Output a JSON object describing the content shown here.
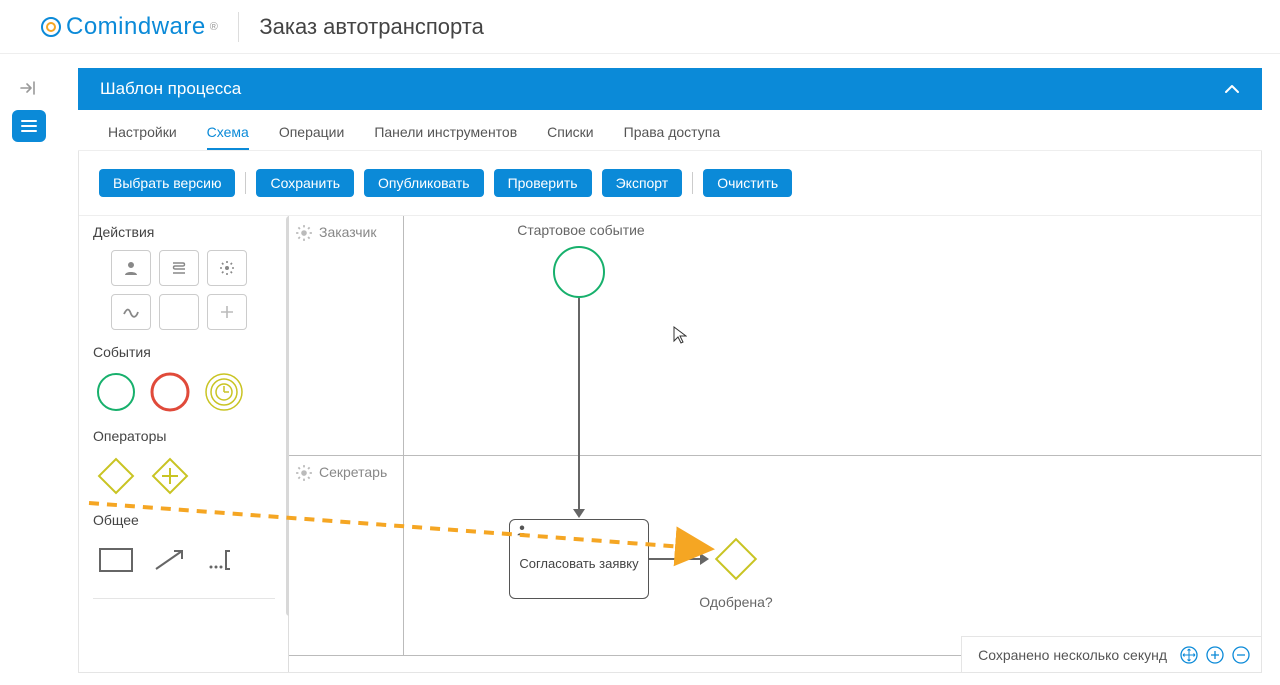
{
  "brand": "Comindware",
  "app_title": "Заказ автотранспорта",
  "panel_title": "Шаблон процесса",
  "tabs": {
    "settings": "Настройки",
    "schema": "Схема",
    "operations": "Операции",
    "toolbars": "Панели инструментов",
    "lists": "Списки",
    "access": "Права доступа"
  },
  "toolbar": {
    "choose_version": "Выбрать версию",
    "save": "Сохранить",
    "publish": "Опубликовать",
    "check": "Проверить",
    "export": "Экспорт",
    "clear": "Очистить"
  },
  "palette": {
    "actions": "Действия",
    "events": "События",
    "operators": "Операторы",
    "common": "Общее"
  },
  "lanes": {
    "customer": "Заказчик",
    "secretary": "Секретарь"
  },
  "diagram": {
    "start_label": "Стартовое событие",
    "task_label": "Согласовать заявку",
    "gateway_label": "Одобрена?"
  },
  "status": "Сохранено несколько секунд"
}
